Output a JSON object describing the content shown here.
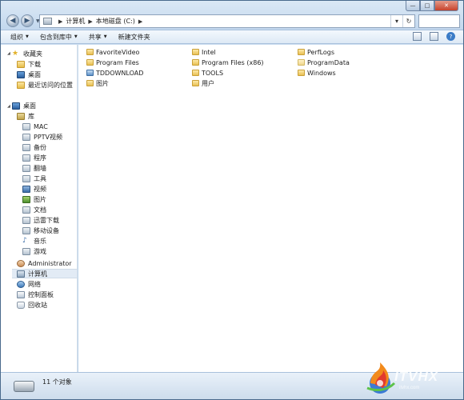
{
  "window": {
    "controls": {
      "minimize": "—",
      "maximize": "□",
      "close": "✕"
    }
  },
  "address": {
    "crumbs": [
      "计算机",
      "本地磁盘 (C:)"
    ]
  },
  "toolbar": {
    "items": [
      "组织",
      "包含到库中",
      "共享",
      "新建文件夹"
    ]
  },
  "nav": {
    "favorites_header": "收藏夹",
    "favorites": [
      "下载",
      "桌面",
      "最近访问的位置"
    ],
    "desktop": "桌面",
    "library": "库",
    "library_items": [
      "MAC",
      "PPTV视频",
      "备份",
      "程序",
      "翻墙",
      "工具",
      "视频",
      "图片",
      "文档",
      "迅雷下载",
      "移动设备",
      "音乐",
      "游戏"
    ],
    "user": "Administrator",
    "computer": "计算机",
    "network": "网络",
    "control_panel": "控制面板",
    "recycle_bin": "回收站"
  },
  "files": [
    "FavoriteVideo",
    "Program Files",
    "TDDOWNLOAD",
    "图片",
    "Intel",
    "Program Files (x86)",
    "TOOLS",
    "用户",
    "PerfLogs",
    "ProgramData",
    "Windows"
  ],
  "status": {
    "count": "11 个对象"
  },
  "watermark": {
    "brand": "ITVHX",
    "sub": "itvhx.com"
  }
}
